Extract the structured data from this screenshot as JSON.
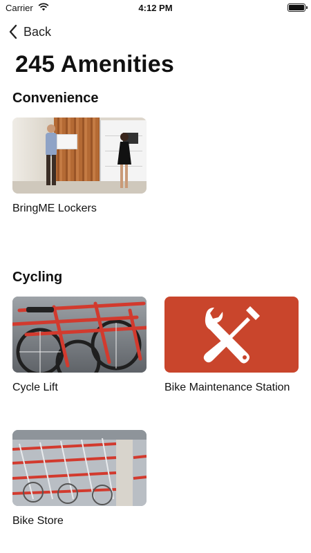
{
  "status_bar": {
    "carrier": "Carrier",
    "time": "4:12 PM",
    "wifi_icon": "wifi-icon",
    "battery_icon": "battery-icon"
  },
  "nav": {
    "back_label": "Back",
    "back_icon": "chevron-left-icon"
  },
  "page": {
    "title": "245 Amenities"
  },
  "sections": [
    {
      "title": "Convenience",
      "items": [
        {
          "label": "BringME Lockers",
          "image": "lockers-photo"
        }
      ]
    },
    {
      "title": "Cycling",
      "items": [
        {
          "label": "Cycle Lift",
          "image": "bike-rack-photo"
        },
        {
          "label": "Bike Maintenance Station",
          "image": "wrench-screwdriver-icon"
        },
        {
          "label": "Bike Store",
          "image": "bike-storage-photo"
        }
      ]
    }
  ],
  "colors": {
    "maintenance_tile": "#c9452c",
    "text": "#111111",
    "background": "#ffffff"
  }
}
